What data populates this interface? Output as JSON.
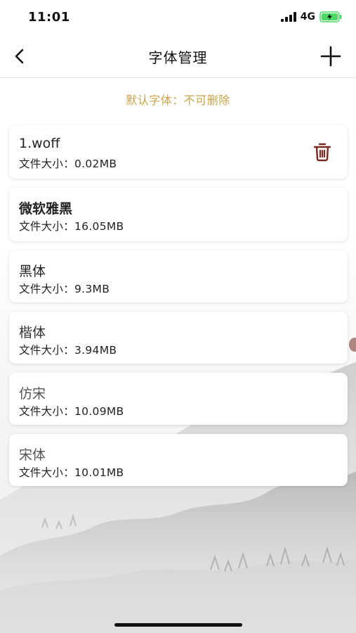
{
  "status_bar": {
    "time": "11:01",
    "network": "4G"
  },
  "nav": {
    "title": "字体管理",
    "icons": {
      "back": "chevron-left-icon",
      "add": "plus-icon"
    }
  },
  "notice": "默认字体：不可删除",
  "fonts": [
    {
      "name": "1.woff",
      "size_label": "文件大小：0.02MB",
      "deletable": true
    },
    {
      "name": "微软雅黑",
      "size_label": "文件大小：16.05MB",
      "deletable": false
    },
    {
      "name": "黑体",
      "size_label": "文件大小：9.3MB",
      "deletable": false
    },
    {
      "name": "楷体",
      "size_label": "文件大小：3.94MB",
      "deletable": false
    },
    {
      "name": "仿宋",
      "size_label": "文件大小：10.09MB",
      "deletable": false
    },
    {
      "name": "宋体",
      "size_label": "文件大小：10.01MB",
      "deletable": false
    }
  ],
  "colors": {
    "notice": "#c9a44a",
    "delete_icon": "#7a2a20",
    "battery": "#4cd964"
  }
}
